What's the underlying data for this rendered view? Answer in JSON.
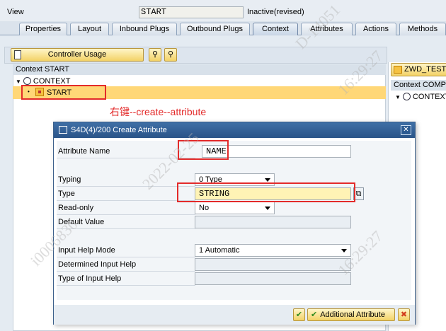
{
  "view": {
    "label": "View",
    "value": "START",
    "status": "Inactive(revised)"
  },
  "tabs": [
    {
      "label": "Properties"
    },
    {
      "label": "Layout"
    },
    {
      "label": "Inbound Plugs"
    },
    {
      "label": "Outbound Plugs"
    },
    {
      "label": "Context"
    },
    {
      "label": "Attributes"
    },
    {
      "label": "Actions"
    },
    {
      "label": "Methods"
    }
  ],
  "toolbar": {
    "controller_usage": "Controller Usage"
  },
  "context_panel": {
    "header": "Context START",
    "root_node": "CONTEXT",
    "child_node": "START"
  },
  "annotation": "右键--create--attribute",
  "right_panel": {
    "button_label": "ZWD_TEST_",
    "header": "Context COMPO",
    "root_node": "CONTEXT"
  },
  "dialog": {
    "title": "S4D(4)/200 Create Attribute",
    "close": "✕",
    "fields": {
      "attribute_name": {
        "label": "Attribute Name",
        "value": "NAME"
      },
      "typing": {
        "label": "Typing",
        "value": "0 Type"
      },
      "type": {
        "label": "Type",
        "value": "STRING"
      },
      "read_only": {
        "label": "Read-only",
        "value": "No"
      },
      "default_value": {
        "label": "Default Value",
        "value": ""
      },
      "input_help_mode": {
        "label": "Input Help Mode",
        "value": "1 Automatic"
      },
      "determined_input_help": {
        "label": "Determined Input Help",
        "value": ""
      },
      "type_of_input_help": {
        "label": "Type of Input Help",
        "value": ""
      }
    },
    "footer": {
      "additional_attribute": "Additional Attribute"
    }
  },
  "icons": {
    "ok": "✔",
    "cancel": "✖",
    "binoculars": "⚲",
    "value_help": "⧉"
  },
  "watermark": [
    "2022-02-25",
    "16:29:27",
    "D-14051",
    "i0006830"
  ],
  "colors": {
    "accent": "#2a5488",
    "highlight": "#ffd777",
    "annotation": "#e32a2a",
    "button": "#f3d266"
  }
}
